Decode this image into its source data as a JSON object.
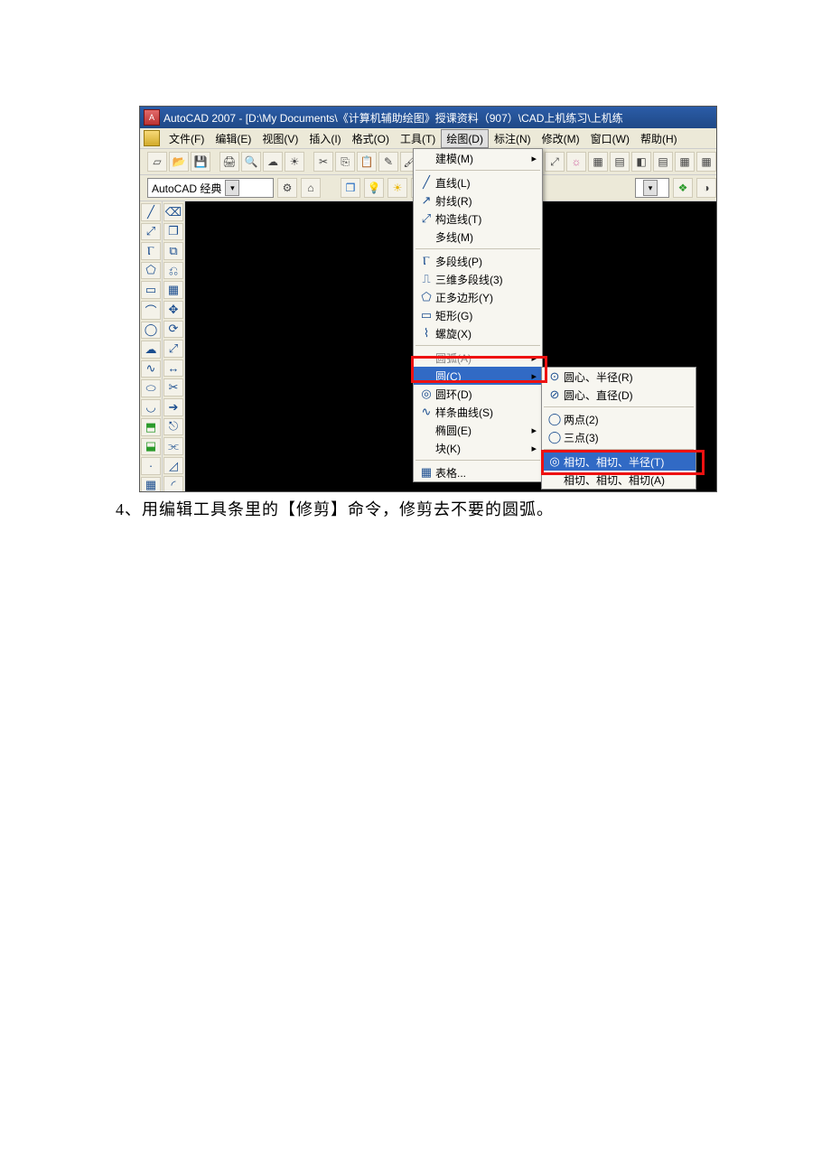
{
  "title": "AutoCAD 2007 - [D:\\My Documents\\《计算机辅助绘图》授课资料（907）\\CAD上机练习\\上机练",
  "menubar": {
    "file": "文件(F)",
    "edit": "编辑(E)",
    "view": "视图(V)",
    "insert": "插入(I)",
    "format": "格式(O)",
    "tools": "工具(T)",
    "draw": "绘图(D)",
    "dim": "标注(N)",
    "modify": "修改(M)",
    "window": "窗口(W)",
    "help": "帮助(H)"
  },
  "workspace_label": "AutoCAD 经典",
  "draw_menu": {
    "model": "建模(M)",
    "line": "直线(L)",
    "ray": "射线(R)",
    "xline": "构造线(T)",
    "mline": "多线(M)",
    "pline": "多段线(P)",
    "3dpoly": "三维多段线(3)",
    "polygon": "正多边形(Y)",
    "rect": "矩形(G)",
    "helix": "螺旋(X)",
    "arc": "圆弧(A)",
    "circle": "圆(C)",
    "donut": "圆环(D)",
    "spline": "样条曲线(S)",
    "ellipse": "椭圆(E)",
    "block": "块(K)",
    "table": "表格..."
  },
  "circle_sub": {
    "center_radius": "圆心、半径(R)",
    "center_diam": "圆心、直径(D)",
    "two_pt": "两点(2)",
    "three_pt": "三点(3)",
    "ttr": "相切、相切、半径(T)",
    "tta": "相切、相切、相切(A)"
  },
  "right_tool_icons": [
    "⟲",
    "▦",
    "▤",
    "◧",
    "▤",
    "▦",
    "▦"
  ],
  "caption": "4、用编辑工具条里的【修剪】命令，修剪去不要的圆弧。"
}
